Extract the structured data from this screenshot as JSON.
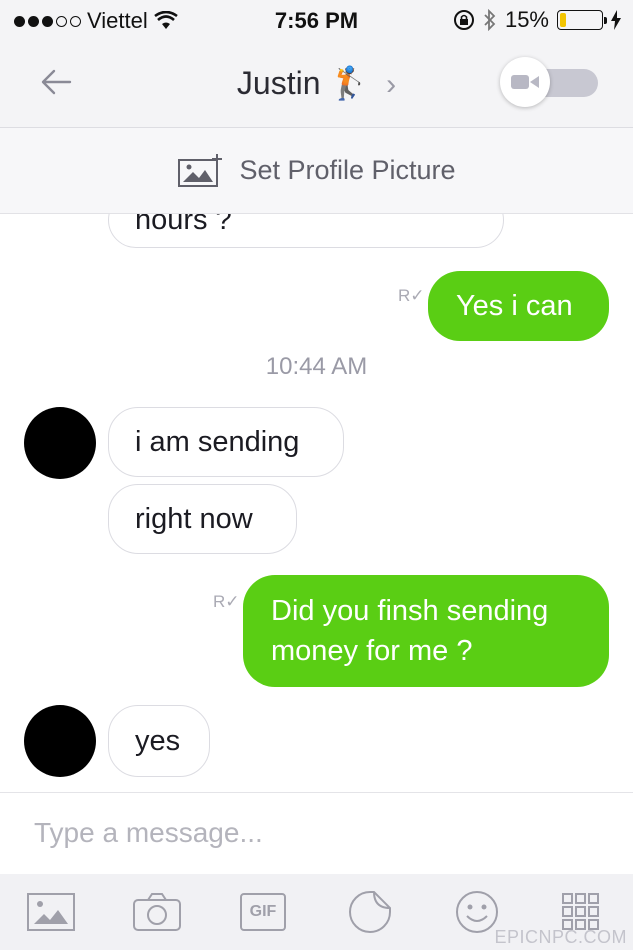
{
  "status_bar": {
    "carrier": "Viettel",
    "time": "7:56 PM",
    "battery_percent": "15%",
    "battery_level": 0.15
  },
  "header": {
    "contact_name": "Justin",
    "contact_emoji": "🏌",
    "chevron": "›"
  },
  "profile_bar": {
    "label": "Set Profile Picture"
  },
  "chat": {
    "partial_message": "hours ?",
    "time_separator": "10:44 AM",
    "read_mark": "R",
    "messages": [
      {
        "direction": "outgoing",
        "text": "Yes i can"
      },
      {
        "direction": "incoming",
        "text": "i am sending"
      },
      {
        "direction": "incoming",
        "text": "right now"
      },
      {
        "direction": "outgoing",
        "text": "Did you finsh sending money for me ?"
      },
      {
        "direction": "incoming",
        "text": "yes"
      }
    ]
  },
  "input": {
    "placeholder": "Type a message..."
  },
  "toolbar": {
    "gif_label": "GIF",
    "icons": [
      "image-icon",
      "camera-icon",
      "gif-icon",
      "sticker-icon",
      "emoji-icon",
      "grid-icon"
    ]
  },
  "watermark": "EPICNPC.COM",
  "colors": {
    "outgoing_bubble": "#5ace14",
    "battery": "#f2c400"
  }
}
